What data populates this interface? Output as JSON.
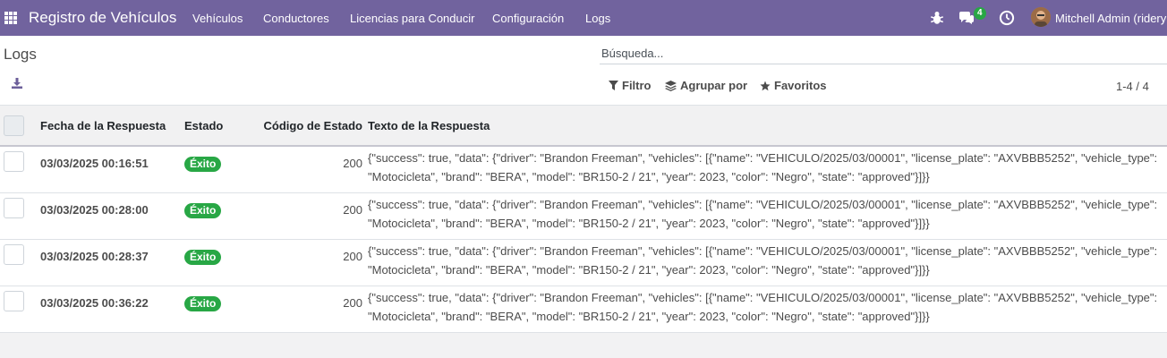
{
  "navbar": {
    "brand": "Registro de Vehículos",
    "menu": [
      "Vehículos",
      "Conductores",
      "Licencias para Conducir",
      "Configuración",
      "Logs"
    ],
    "messages_count": "4",
    "user_name": "Mitchell Admin (ridery"
  },
  "control_panel": {
    "breadcrumb": "Logs",
    "search_placeholder": "Búsqueda...",
    "filter_label": "Filtro",
    "group_by_label": "Agrupar por",
    "favorites_label": "Favoritos",
    "pager": "1-4 / 4"
  },
  "table": {
    "headers": [
      "Fecha de la Respuesta",
      "Estado",
      "Código de Estado",
      "Texto de la Respuesta"
    ],
    "rows": [
      {
        "date": "03/03/2025 00:16:51",
        "status": "Éxito",
        "code": "200",
        "text": "{\"success\": true, \"data\": {\"driver\": \"Brandon Freeman\", \"vehicles\": [{\"name\": \"VEHICULO/2025/03/00001\", \"license_plate\": \"AXVBBB5252\", \"vehicle_type\": \"Motocicleta\", \"brand\": \"BERA\", \"model\": \"BR150-2 / 21\", \"year\": 2023, \"color\": \"Negro\", \"state\": \"approved\"}]}}"
      },
      {
        "date": "03/03/2025 00:28:00",
        "status": "Éxito",
        "code": "200",
        "text": "{\"success\": true, \"data\": {\"driver\": \"Brandon Freeman\", \"vehicles\": [{\"name\": \"VEHICULO/2025/03/00001\", \"license_plate\": \"AXVBBB5252\", \"vehicle_type\": \"Motocicleta\", \"brand\": \"BERA\", \"model\": \"BR150-2 / 21\", \"year\": 2023, \"color\": \"Negro\", \"state\": \"approved\"}]}}"
      },
      {
        "date": "03/03/2025 00:28:37",
        "status": "Éxito",
        "code": "200",
        "text": "{\"success\": true, \"data\": {\"driver\": \"Brandon Freeman\", \"vehicles\": [{\"name\": \"VEHICULO/2025/03/00001\", \"license_plate\": \"AXVBBB5252\", \"vehicle_type\": \"Motocicleta\", \"brand\": \"BERA\", \"model\": \"BR150-2 / 21\", \"year\": 2023, \"color\": \"Negro\", \"state\": \"approved\"}]}}"
      },
      {
        "date": "03/03/2025 00:36:22",
        "status": "Éxito",
        "code": "200",
        "text": "{\"success\": true, \"data\": {\"driver\": \"Brandon Freeman\", \"vehicles\": [{\"name\": \"VEHICULO/2025/03/00001\", \"license_plate\": \"AXVBBB5252\", \"vehicle_type\": \"Motocicleta\", \"brand\": \"BERA\", \"model\": \"BR150-2 / 21\", \"year\": 2023, \"color\": \"Negro\", \"state\": \"approved\"}]}}"
      }
    ]
  },
  "icons": {
    "apps": "apps-grid-icon",
    "bug": "bug-icon",
    "chat": "chat-icon",
    "clock": "clock-icon",
    "download": "download-icon",
    "filter": "filter-icon",
    "group_by": "layers-icon",
    "favorites": "star-icon"
  },
  "colors": {
    "navbar": "#71639e",
    "success_badge": "#28a745"
  }
}
